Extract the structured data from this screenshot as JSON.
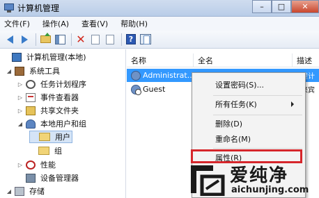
{
  "window": {
    "title": "计算机管理"
  },
  "menu": [
    "文件(F)",
    "操作(A)",
    "查看(V)",
    "帮助(H)"
  ],
  "tree": [
    {
      "label": "计算机管理(本地)",
      "icon": "computer-icon",
      "expander": ""
    },
    {
      "label": "系统工具",
      "icon": "tools-icon",
      "expander": "◢"
    },
    {
      "label": "任务计划程序",
      "icon": "clock-icon",
      "expander": "▷"
    },
    {
      "label": "事件查看器",
      "icon": "event-viewer-icon",
      "expander": "▷"
    },
    {
      "label": "共享文件夹",
      "icon": "shared-folder-icon",
      "expander": "▷"
    },
    {
      "label": "本地用户和组",
      "icon": "users-icon",
      "expander": "◢"
    },
    {
      "label": "用户",
      "icon": "folder-icon",
      "expander": ""
    },
    {
      "label": "组",
      "icon": "folder-icon",
      "expander": ""
    },
    {
      "label": "性能",
      "icon": "performance-icon",
      "expander": "▷"
    },
    {
      "label": "设备管理器",
      "icon": "device-manager-icon",
      "expander": ""
    },
    {
      "label": "存储",
      "icon": "storage-icon",
      "expander": "◢"
    }
  ],
  "list": {
    "columns": [
      "名称",
      "全名",
      "描述"
    ],
    "rows": [
      {
        "name": "Administrat...",
        "desc": "管理计"
      },
      {
        "name": "Guest",
        "desc": "供来宾"
      }
    ]
  },
  "context_menu": {
    "items": [
      "设置密码(S)...",
      "所有任务(K)",
      "删除(D)",
      "重命名(M)",
      "属性(R)"
    ]
  },
  "watermark": {
    "title": "爱纯净",
    "url": "aichunjing.com"
  }
}
